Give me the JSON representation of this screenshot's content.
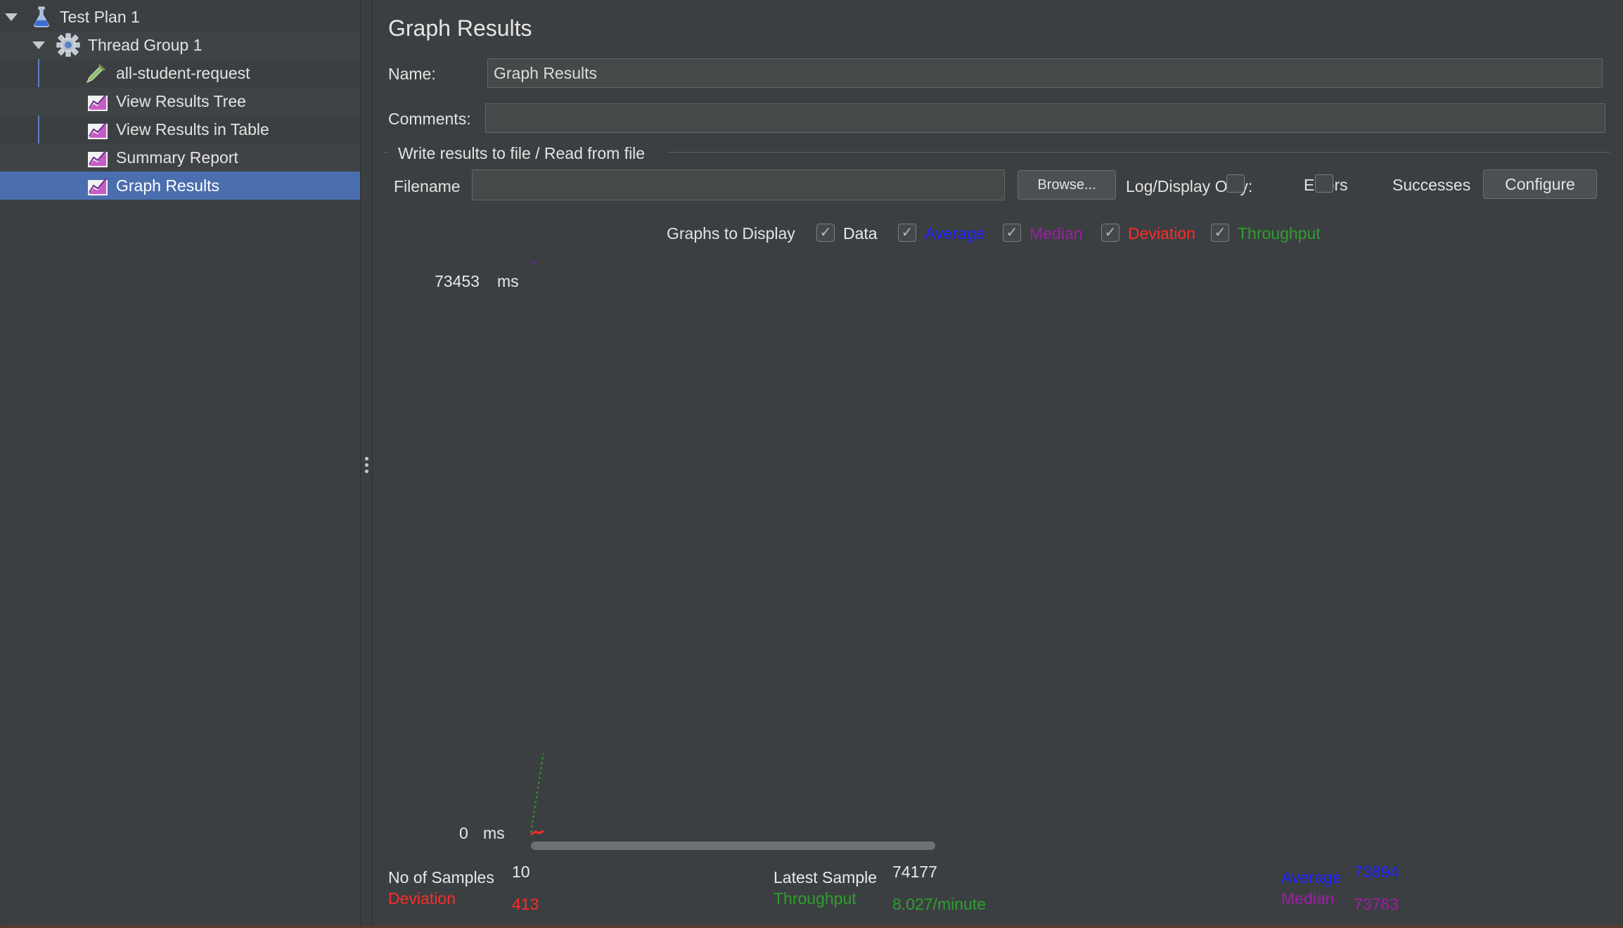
{
  "tree": [
    {
      "label": "Test Plan 1",
      "icon": "flask-icon",
      "expanded": true
    },
    {
      "label": "Thread Group 1",
      "icon": "gear-icon",
      "expanded": true
    },
    {
      "label": "all-student-request",
      "icon": "pipette-icon"
    },
    {
      "label": "View Results Tree",
      "icon": "graph-listener-icon"
    },
    {
      "label": "View Results in Table",
      "icon": "graph-listener-icon"
    },
    {
      "label": "Summary Report",
      "icon": "graph-listener-icon"
    },
    {
      "label": "Graph Results",
      "icon": "graph-listener-icon",
      "selected": true
    }
  ],
  "panel": {
    "title": "Graph Results",
    "name_label": "Name:",
    "name_value": "Graph Results",
    "comments_label": "Comments:",
    "comments_value": "",
    "file_group_title": "Write results to file / Read from file",
    "filename_label": "Filename",
    "filename_value": "",
    "browse_label": "Browse...",
    "log_display_label": "Log/Display Only:",
    "errors_label": "Errors",
    "errors_checked": false,
    "successes_label": "Successes",
    "successes_checked": false,
    "configure_label": "Configure"
  },
  "graphs_to_display": {
    "label": "Graphs to Display",
    "options": [
      {
        "label": "Data",
        "checked": true,
        "color": "#e8e8e8"
      },
      {
        "label": "Average",
        "checked": true,
        "color": "#1f1fff"
      },
      {
        "label": "Median",
        "checked": true,
        "color": "#9b1fa3"
      },
      {
        "label": "Deviation",
        "checked": true,
        "color": "#ff2a2a"
      },
      {
        "label": "Throughput",
        "checked": true,
        "color": "#2e9e2e"
      }
    ]
  },
  "chart_data": {
    "type": "line",
    "y_max_label": "73453",
    "y_min_label": "0",
    "y_unit": "ms",
    "ylim": [
      0,
      73453
    ]
  },
  "stats": {
    "samples_label": "No of Samples",
    "samples_value": "10",
    "deviation_label": "Deviation",
    "deviation_value": "413",
    "latest_label": "Latest Sample",
    "latest_value": "74177",
    "throughput_label": "Throughput",
    "throughput_value": "8.027/minute",
    "average_label": "Average",
    "average_value": "73894",
    "median_label": "Median",
    "median_value": "73783"
  },
  "colors": {
    "average": "#1f1fff",
    "median": "#9b1fa3",
    "deviation": "#ff2a2a",
    "throughput": "#2e9e2e",
    "selection": "#4b6eaf"
  }
}
